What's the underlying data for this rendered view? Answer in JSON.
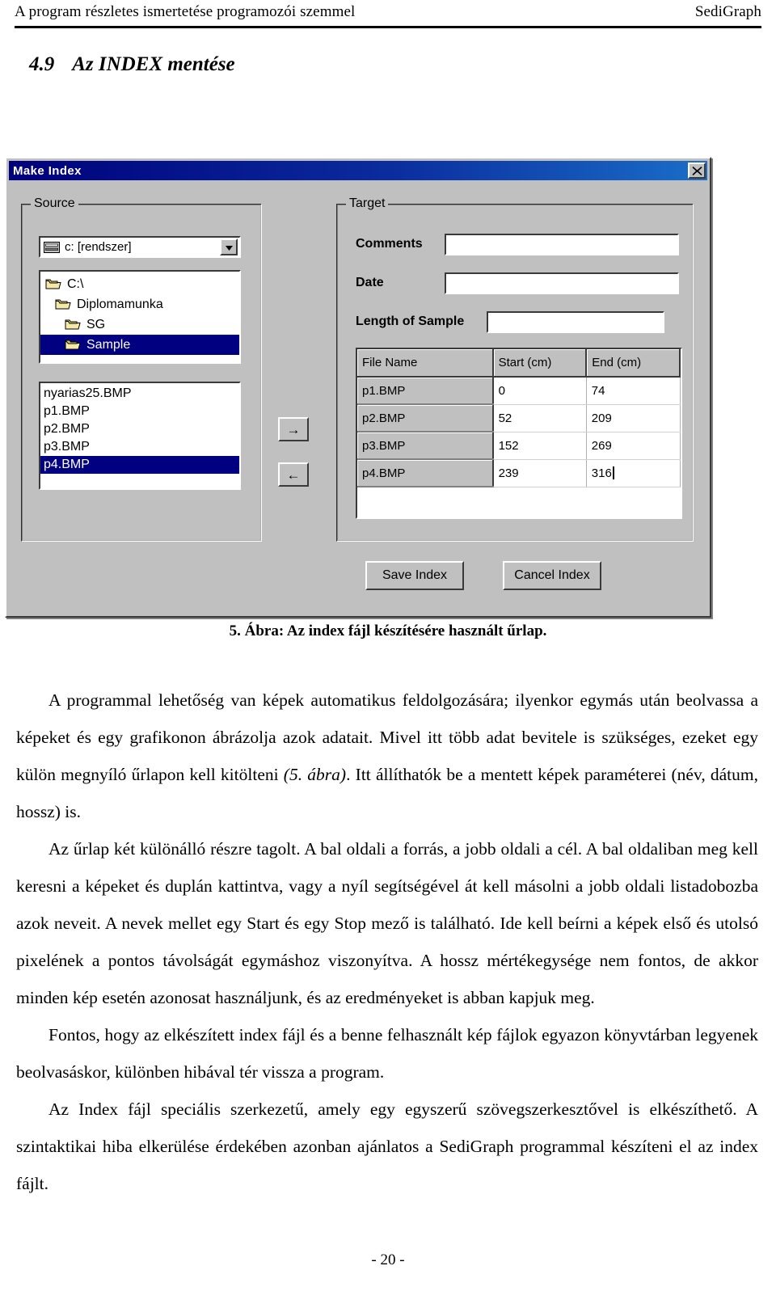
{
  "header": {
    "left": "A program részletes ismertetése programozói szemmel",
    "right": "SediGraph"
  },
  "heading": {
    "number": "4.9",
    "title": "Az INDEX mentése"
  },
  "dialog": {
    "title": "Make Index",
    "close_icon": "close-icon",
    "source": {
      "legend": "Source",
      "drive": {
        "value": "c: [rendszer]",
        "icon": "drive-icon",
        "arrow": "chevron-down-icon"
      },
      "folders": [
        {
          "label": "C:\\",
          "indent": 0,
          "selected": false
        },
        {
          "label": "Diplomamunka",
          "indent": 1,
          "selected": false
        },
        {
          "label": "SG",
          "indent": 2,
          "selected": false
        },
        {
          "label": "Sample",
          "indent": 3,
          "selected": true
        }
      ],
      "files": [
        {
          "label": "nyarias25.BMP",
          "selected": false
        },
        {
          "label": "p1.BMP",
          "selected": false
        },
        {
          "label": "p2.BMP",
          "selected": false
        },
        {
          "label": "p3.BMP",
          "selected": false
        },
        {
          "label": "p4.BMP",
          "selected": true
        }
      ]
    },
    "transfer": {
      "add_label": "→",
      "remove_label": "←"
    },
    "target": {
      "legend": "Target",
      "fields": [
        {
          "label": "Comments",
          "value": ""
        },
        {
          "label": "Date",
          "value": ""
        },
        {
          "label": "Length of Sample",
          "value": ""
        }
      ],
      "grid": {
        "columns": [
          "File Name",
          "Start (cm)",
          "End (cm)"
        ],
        "rows": [
          {
            "name": "p1.BMP",
            "start": "0",
            "end": "74"
          },
          {
            "name": "p2.BMP",
            "start": "52",
            "end": "209"
          },
          {
            "name": "p3.BMP",
            "start": "152",
            "end": "269"
          },
          {
            "name": "p4.BMP",
            "start": "239",
            "end": "316"
          }
        ],
        "editing_cell": "p4-end"
      }
    },
    "buttons": {
      "save": "Save Index",
      "cancel": "Cancel Index"
    }
  },
  "figure_caption": "5. Ábra: Az index fájl készítésére használt űrlap.",
  "paragraphs": [
    {
      "indent": true,
      "runs": [
        {
          "text": "A programmal lehetőség van képek automatikus feldolgozására; ilyenkor egymás után beolvassa a képeket és egy grafikonon ábrázolja azok adatait. Mivel itt több adat bevitele is szükséges, ezeket egy külön megnyíló űrlapon kell kitölteni ",
          "italic": false
        },
        {
          "text": "(5. ábra)",
          "italic": true
        },
        {
          "text": ". Itt állíthatók be a mentett képek paraméterei (név, dátum, hossz) is.",
          "italic": false
        }
      ]
    },
    {
      "indent": true,
      "runs": [
        {
          "text": "Az űrlap két különálló részre tagolt. A bal oldali a forrás, a jobb oldali a cél. A bal oldaliban meg kell keresni a képeket és duplán kattintva, vagy a nyíl segítségével át kell másolni a jobb oldali listadobozba azok neveit. A nevek mellet egy Start és egy Stop mező is található. Ide kell beírni a képek első és utolsó pixelének a pontos távolságát egymáshoz viszonyítva. A hossz mértékegysége nem fontos, de akkor minden kép esetén azonosat használjunk, és az eredményeket is abban kapjuk meg.",
          "italic": false
        }
      ]
    },
    {
      "indent": true,
      "runs": [
        {
          "text": "Fontos, hogy az elkészített index fájl és a benne felhasznált kép fájlok egyazon könyvtárban legyenek beolvasáskor, különben hibával tér vissza a program.",
          "italic": false
        }
      ]
    },
    {
      "indent": true,
      "runs": [
        {
          "text": "Az Index fájl speciális szerkezetű, amely egy egyszerű szövegszerkesztővel is elkészíthető. A szintaktikai hiba elkerülése érdekében azonban ajánlatos a SediGraph programmal készíteni el az index fájlt.",
          "italic": false
        }
      ]
    }
  ],
  "footer": "- 20 -"
}
